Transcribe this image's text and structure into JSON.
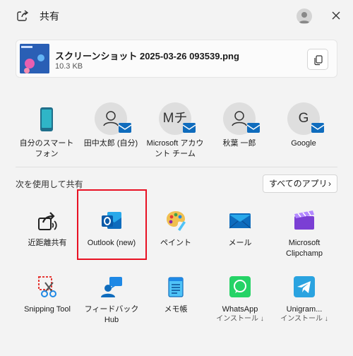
{
  "header": {
    "title": "共有"
  },
  "file": {
    "name": "スクリーンショット 2025-03-26 093539.png",
    "size": "10.3 KB"
  },
  "contacts": [
    {
      "label": "自分のスマート\nフォン",
      "initials": ""
    },
    {
      "label": "田中太郎 (自分)",
      "initials": ""
    },
    {
      "label": "Microsoft アカウ\nント チーム",
      "initials": "Mチ"
    },
    {
      "label": "秋葉 一郎",
      "initials": ""
    },
    {
      "label": "Google",
      "initials": "G"
    }
  ],
  "share_section": {
    "title": "次を使用して共有",
    "all_apps_label": "すべてのアプリ"
  },
  "apps": [
    {
      "label": "近距離共有",
      "sub": "",
      "icon": "nearby-share-icon"
    },
    {
      "label": "Outlook (new)",
      "sub": "",
      "icon": "outlook-icon"
    },
    {
      "label": "ペイント",
      "sub": "",
      "icon": "paint-icon"
    },
    {
      "label": "メール",
      "sub": "",
      "icon": "mail-icon"
    },
    {
      "label": "Microsoft\nClipchamp",
      "sub": "",
      "icon": "clipchamp-icon"
    },
    {
      "label": "Snipping Tool",
      "sub": "",
      "icon": "snipping-tool-icon"
    },
    {
      "label": "フィードバック Hub",
      "sub": "",
      "icon": "feedback-hub-icon"
    },
    {
      "label": "メモ帳",
      "sub": "",
      "icon": "notepad-icon"
    },
    {
      "label": "WhatsApp",
      "sub": "インストール ↓",
      "icon": "whatsapp-icon"
    },
    {
      "label": "Unigram...",
      "sub": "インストール ↓",
      "icon": "unigram-icon"
    }
  ],
  "colors": {
    "highlight": "#e81123",
    "outlook_blue": "#0f6cbd"
  }
}
